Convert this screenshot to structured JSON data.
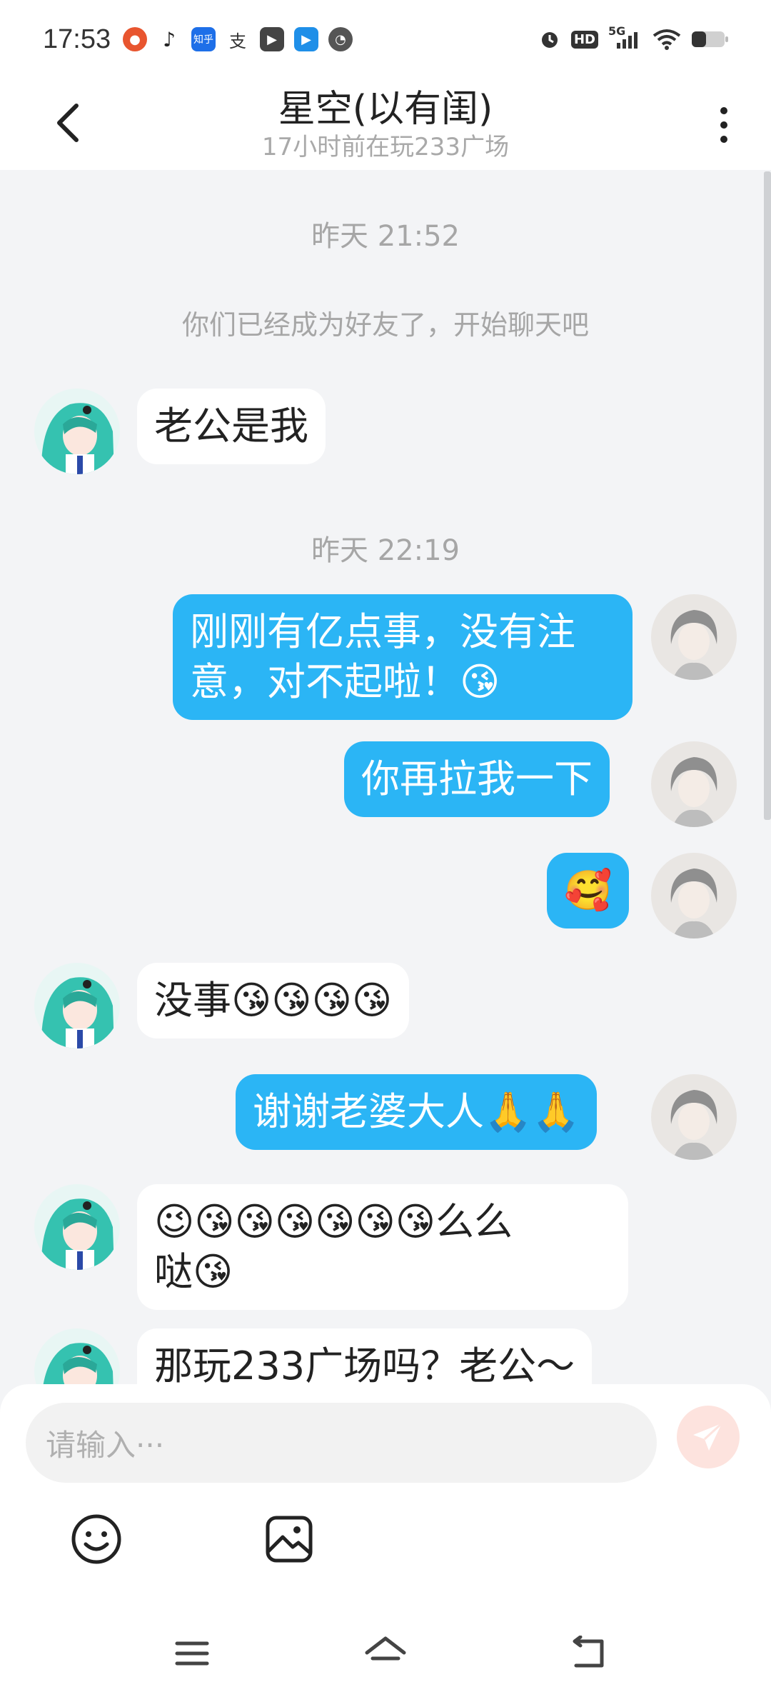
{
  "status_bar": {
    "time": "17:53",
    "app_icons": [
      "game-icon",
      "tiktok-icon",
      "zhihu-icon",
      "alipay-icon",
      "video-icon",
      "bilibili-icon",
      "compass-icon"
    ],
    "zhihu_label": "知乎",
    "right_icons": [
      "alarm-icon",
      "hd-icon",
      "5g-signal-icon",
      "wifi-icon",
      "battery-icon"
    ],
    "hd_label": "HD",
    "network_label": "5G"
  },
  "header": {
    "title": "星空(以有闺)",
    "subtitle": "17小时前在玩233广场"
  },
  "chat": {
    "time1": "昨天  21:52",
    "system_msg": "你们已经成为好友了，开始聊天吧",
    "time2": "昨天  22:19",
    "messages": [
      {
        "side": "in",
        "text": "老公是我"
      },
      {
        "side": "out",
        "line1": "刚刚有亿点事，没有注",
        "line2": "意，对不起啦！😘"
      },
      {
        "side": "out",
        "text": "你再拉我一下"
      },
      {
        "side": "out",
        "text": "🥰"
      },
      {
        "side": "in",
        "text": "没事😘😘😘😘"
      },
      {
        "side": "out",
        "text": "谢谢老婆大人🙏🙏"
      },
      {
        "side": "in",
        "line1": "😉😘😘😘😘😘😘么么",
        "line2": "哒😘"
      },
      {
        "side": "in",
        "text": "那玩233广场吗？老公～"
      }
    ]
  },
  "input": {
    "placeholder": "请输入···"
  },
  "colors": {
    "bubble_out": "#2bb5f5",
    "bubble_in": "#ffffff",
    "background": "#f3f4f6",
    "send_button": "#fde3de"
  }
}
